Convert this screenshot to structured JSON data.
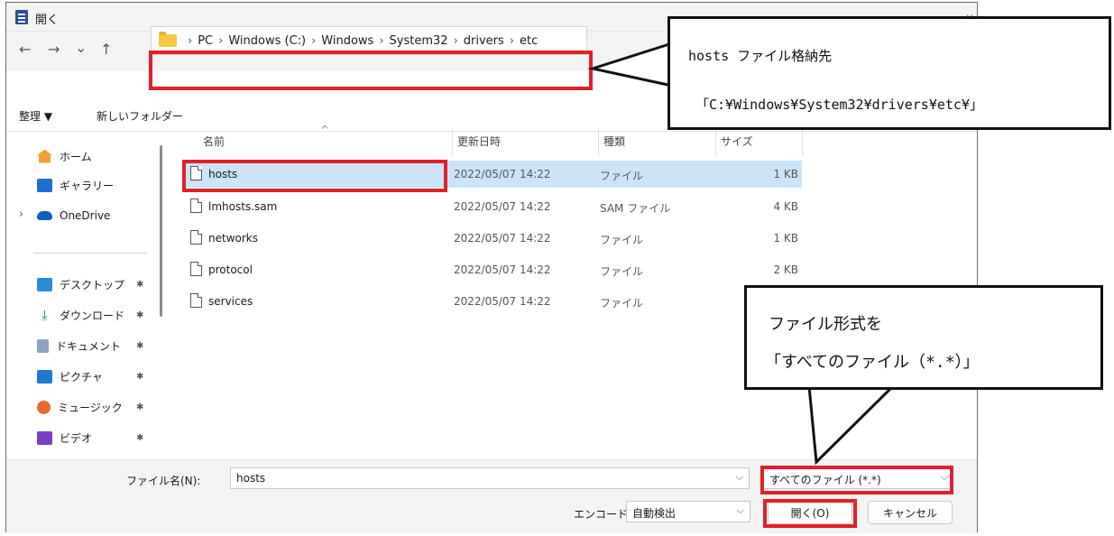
{
  "window": {
    "title": "開く"
  },
  "nav": {
    "back": "←",
    "forward": "→",
    "dropdown": "⌄",
    "up": "↑"
  },
  "address": {
    "crumbs": [
      "PC",
      "Windows (C:)",
      "Windows",
      "System32",
      "drivers",
      "etc"
    ],
    "separator": "›"
  },
  "toolbar": {
    "organize": "整理 ▼",
    "new_folder": "新しいフォルダー"
  },
  "sidebar": {
    "items": [
      {
        "label": "ホーム",
        "icon": "home-icon"
      },
      {
        "label": "ギャラリー",
        "icon": "gallery-icon"
      },
      {
        "label": "OneDrive",
        "icon": "cloud-icon",
        "expander": "›"
      },
      {
        "label": "デスクトップ",
        "icon": "desktop-icon",
        "pin": "📌"
      },
      {
        "label": "ダウンロード",
        "icon": "download-icon",
        "pin": "📌"
      },
      {
        "label": "ドキュメント",
        "icon": "document-icon",
        "pin": "📌"
      },
      {
        "label": "ピクチャ",
        "icon": "pictures-icon",
        "pin": "📌"
      },
      {
        "label": "ミュージック",
        "icon": "music-icon",
        "pin": "📌"
      },
      {
        "label": "ビデオ",
        "icon": "video-icon",
        "pin": "📌"
      }
    ]
  },
  "columns": {
    "name": "名前",
    "date": "更新日時",
    "type": "種類",
    "size": "サイズ",
    "sort_indicator": "^"
  },
  "files": [
    {
      "name": "hosts",
      "date": "2022/05/07 14:22",
      "type": "ファイル",
      "size": "1 KB",
      "selected": true
    },
    {
      "name": "lmhosts.sam",
      "date": "2022/05/07 14:22",
      "type": "SAM ファイル",
      "size": "4 KB"
    },
    {
      "name": "networks",
      "date": "2022/05/07 14:22",
      "type": "ファイル",
      "size": "1 KB"
    },
    {
      "name": "protocol",
      "date": "2022/05/07 14:22",
      "type": "ファイル",
      "size": "2 KB"
    },
    {
      "name": "services",
      "date": "2022/05/07 14:22",
      "type": "ファイル",
      "size": ""
    }
  ],
  "footer": {
    "filename_label": "ファイル名(N):",
    "filename_value": "hosts",
    "filetype_value": "すべてのファイル (*.*)",
    "encoding_label": "エンコード:",
    "encoding_value": "自動検出",
    "open_button": "開く(O)",
    "cancel_button": "キャンセル"
  },
  "annotations": {
    "path_callout_line1": "hosts ファイル格納先",
    "path_callout_line2": "「C:¥Windows¥System32¥drivers¥etc¥」",
    "type_callout_line1": "ファイル形式を",
    "type_callout_line2": "「すべてのファイル（*.*）」"
  },
  "colors": {
    "highlight": "#e0202a",
    "selection": "#cce4f7",
    "accent": "#0067c0"
  }
}
